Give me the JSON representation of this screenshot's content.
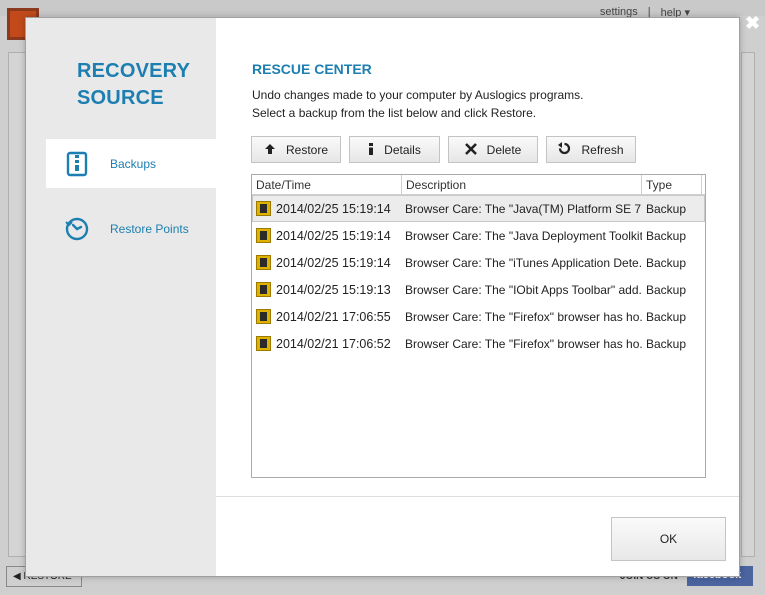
{
  "background": {
    "links": [
      "settings",
      "|",
      "help ▾"
    ],
    "restore_label": "◀ RESTORE",
    "joinus": "JOIN US ON",
    "facebook": "facebook"
  },
  "dialog": {
    "sidebar": {
      "title_line1": "RECOVERY",
      "title_line2": "SOURCE",
      "items": [
        {
          "label": "Backups",
          "icon": "archive-icon",
          "active": true
        },
        {
          "label": "Restore Points",
          "icon": "clock-restore-icon",
          "active": false
        }
      ]
    },
    "main": {
      "title": "RESCUE CENTER",
      "desc_line1": "Undo changes made to your computer by Auslogics programs.",
      "desc_line2": "Select a backup from the list below and click Restore.",
      "toolbar": {
        "restore": "Restore",
        "details": "Details",
        "delete": "Delete",
        "refresh": "Refresh"
      },
      "table": {
        "headers": [
          "Date/Time",
          "Description",
          "Type"
        ],
        "rows": [
          {
            "date": "2014/02/25 15:19:14",
            "description": "Browser Care: The \"Java(TM) Platform SE 7 ...",
            "type": "Backup",
            "selected": true
          },
          {
            "date": "2014/02/25 15:19:14",
            "description": "Browser Care: The \"Java Deployment Toolkit ...",
            "type": "Backup",
            "selected": false
          },
          {
            "date": "2014/02/25 15:19:14",
            "description": "Browser Care: The \"iTunes Application Dete...",
            "type": "Backup",
            "selected": false
          },
          {
            "date": "2014/02/25 15:19:13",
            "description": "Browser Care: The \"IObit Apps Toolbar\" add...",
            "type": "Backup",
            "selected": false
          },
          {
            "date": "2014/02/21 17:06:55",
            "description": "Browser Care: The \"Firefox\" browser has ho...",
            "type": "Backup",
            "selected": false
          },
          {
            "date": "2014/02/21 17:06:52",
            "description": "Browser Care: The \"Firefox\" browser has ho...",
            "type": "Backup",
            "selected": false
          }
        ]
      }
    },
    "ok_label": "OK",
    "close_glyph": "✖"
  },
  "colors": {
    "accent": "#1d7fb1",
    "row_icon": "#e0b200"
  }
}
